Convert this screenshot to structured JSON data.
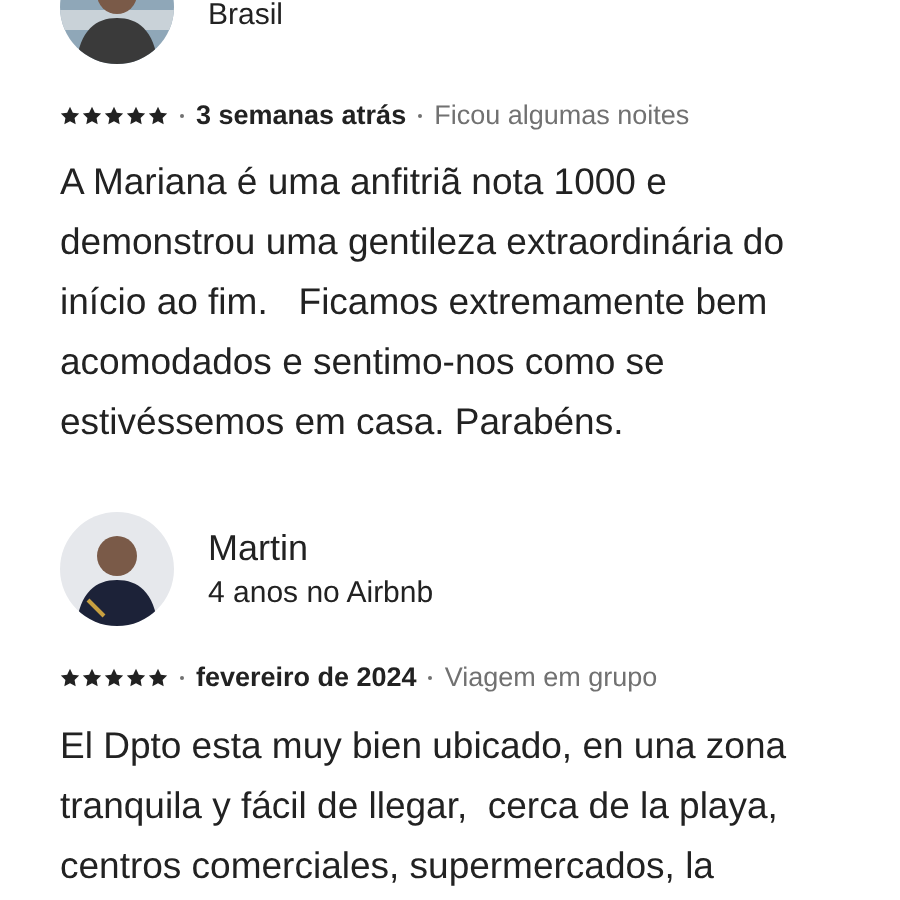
{
  "reviews": [
    {
      "subtitle": "Brasil",
      "stars": 5,
      "date": "3 semanas atrás",
      "stay": "Ficou algumas noites",
      "text": "A Mariana é uma anfitriã nota 1000 e demonstrou uma gentileza extraordinária do início ao fim.   Ficamos extremamente bem acomodados e sentimo-nos como se estivéssemos em casa. Parabéns."
    },
    {
      "name": "Martin",
      "subtitle": "4 anos no Airbnb",
      "stars": 5,
      "date": "fevereiro de 2024",
      "stay": "Viagem em grupo",
      "text": "El Dpto esta muy bien ubicado, en una zona tranquila y fácil de llegar,  cerca de la playa, centros comerciales, supermercados, la"
    }
  ]
}
